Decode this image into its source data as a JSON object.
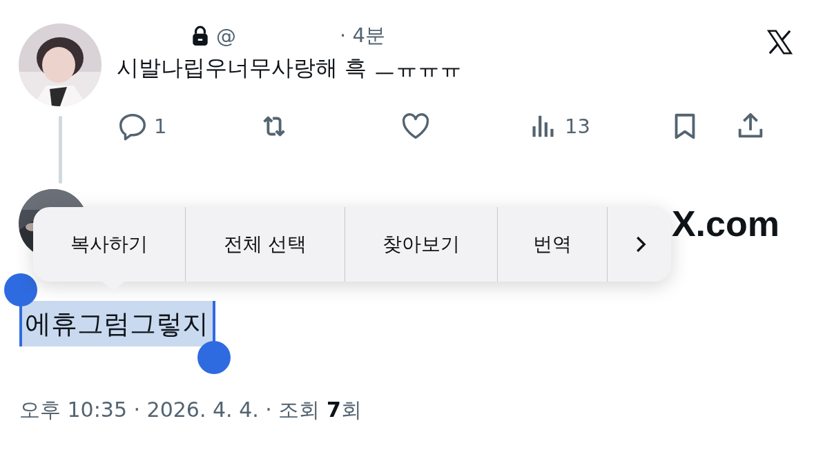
{
  "post": {
    "handle_prefix": "@",
    "time": "· 4분",
    "text": "시발나립우너무사랑해 흑 ㅡㅠㅠㅠ",
    "actions": [
      {
        "kind": "reply",
        "count": "1"
      },
      {
        "kind": "repost"
      },
      {
        "kind": "like"
      },
      {
        "kind": "views",
        "count": "13"
      },
      {
        "kind": "bookmark"
      },
      {
        "kind": "share"
      }
    ]
  },
  "link_card": {
    "domain": "X.com"
  },
  "context_menu": {
    "items": [
      "복사하기",
      "전체 선택",
      "찾아보기",
      "번역"
    ]
  },
  "reply": {
    "text": "에휴그럼그렇지",
    "selected": true
  },
  "footer": "오후 10:35 · 2026. 4. 4. · 조회 **7**회"
}
